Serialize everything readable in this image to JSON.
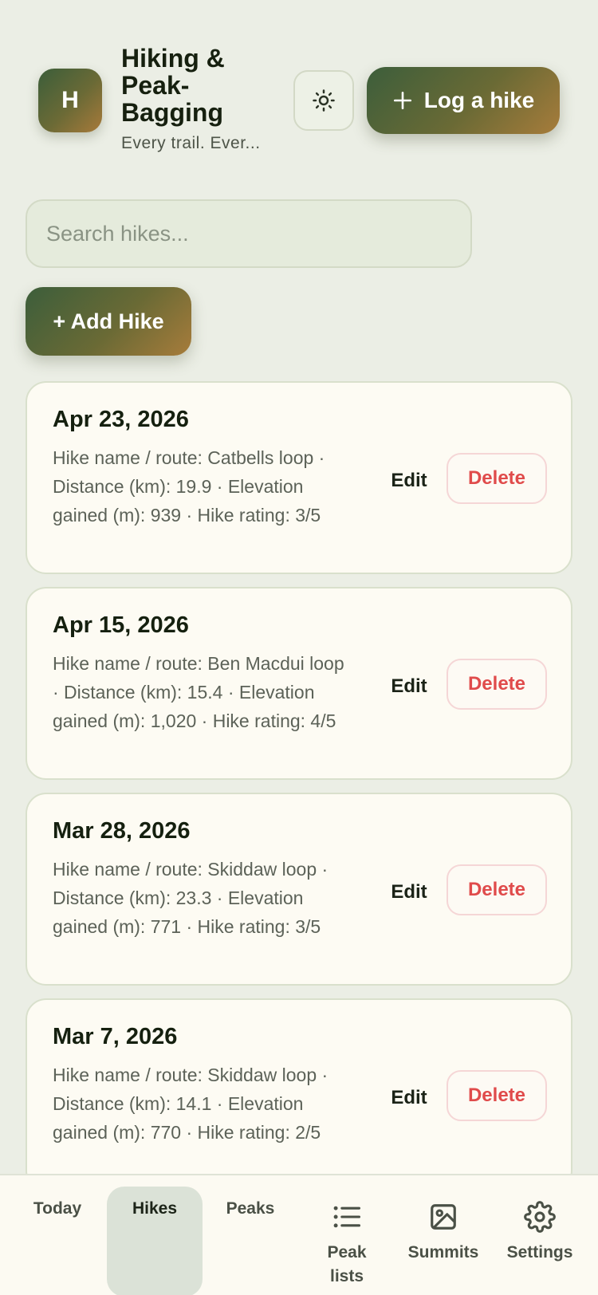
{
  "header": {
    "avatar_letter": "H",
    "title": "Hiking & Peak-Bagging",
    "subtitle": "Every trail. Ever...",
    "log_button_label": "Log a hike"
  },
  "search": {
    "placeholder": "Search hikes..."
  },
  "add_button_label": "+ Add Hike",
  "actions": {
    "edit_label": "Edit",
    "delete_label": "Delete"
  },
  "hikes": [
    {
      "date": "Apr 23, 2026",
      "details": "Hike name / route: Catbells loop · Distance (km): 19.9 · Elevation gained (m): 939 · Hike rating: 3/5"
    },
    {
      "date": "Apr 15, 2026",
      "details": "Hike name / route: Ben Macdui loop · Distance (km): 15.4 · Elevation gained (m): 1,020 · Hike rating: 4/5"
    },
    {
      "date": "Mar 28, 2026",
      "details": "Hike name / route: Skiddaw loop · Distance (km): 23.3 · Elevation gained (m): 771 · Hike rating: 3/5"
    },
    {
      "date": "Mar 7, 2026",
      "details": "Hike name / route: Skiddaw loop · Distance (km): 14.1 · Elevation gained (m): 770 · Hike rating: 2/5"
    }
  ],
  "nav": [
    {
      "label": "Today",
      "icon": "none",
      "active": false
    },
    {
      "label": "Hikes",
      "icon": "none",
      "active": true
    },
    {
      "label": "Peaks",
      "icon": "none",
      "active": false
    },
    {
      "label": "Peak lists",
      "icon": "list-icon",
      "active": false
    },
    {
      "label": "Summits",
      "icon": "image-icon",
      "active": false
    },
    {
      "label": "Settings",
      "icon": "gear-icon",
      "active": false
    }
  ],
  "colors": {
    "background": "#ebeee5",
    "card": "#fdfbf3",
    "accent_start": "#3c5e3b",
    "accent_end": "#a77c3b",
    "delete": "#e04b4b",
    "nav_active": "#dbe2d7"
  }
}
